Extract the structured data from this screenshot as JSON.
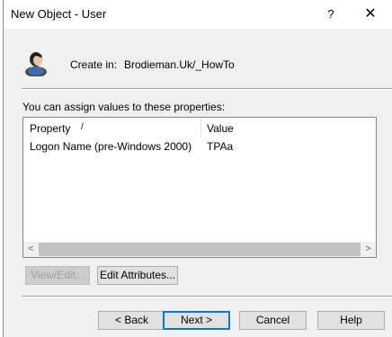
{
  "window": {
    "title": "New Object - User",
    "help_glyph": "?",
    "close_glyph": "✕"
  },
  "header": {
    "create_in_label": "Create in:",
    "create_in_path": "Brodieman.Uk/_HowTo",
    "icon": "user-icon"
  },
  "properties": {
    "instructions": "You can assign values to these properties:",
    "columns": [
      "Property",
      "Value"
    ],
    "sort_indicator": "/",
    "rows": [
      {
        "property": "Logon Name (pre-Windows 2000)",
        "value": "TPAa"
      }
    ],
    "scroll_left": "<",
    "scroll_right": ">"
  },
  "actions": {
    "view_edit": "View/Edit...",
    "edit_attributes": "Edit Attributes..."
  },
  "footer": {
    "back": "< Back",
    "next": "Next >",
    "cancel": "Cancel",
    "help": "Help"
  }
}
